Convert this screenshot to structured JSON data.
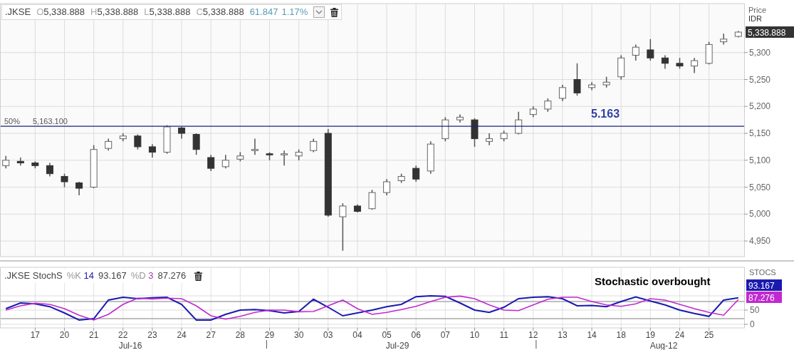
{
  "price_panel": {
    "legend": {
      "symbol": ".JKSE",
      "fields": [
        {
          "key": "O",
          "value": "5,338.888"
        },
        {
          "key": "H",
          "value": "5,338.888"
        },
        {
          "key": "L",
          "value": "5,338.888"
        },
        {
          "key": "C",
          "value": "5,338.888"
        }
      ],
      "change": "61.847",
      "change_percent": "1.17%"
    },
    "axis_title": [
      "Price",
      "IDR"
    ],
    "last_price": "5,338.888",
    "chart_data": {
      "type": "candlestick",
      "grid": true,
      "ylim": [
        4921,
        5391
      ],
      "categories": [
        null,
        null,
        null,
        null,
        null,
        null,
        null,
        null,
        null,
        null,
        null,
        null,
        null,
        null,
        null,
        null,
        null,
        null,
        null,
        null,
        null,
        null,
        null,
        null,
        null,
        null,
        null,
        null,
        null,
        null,
        null,
        null,
        null,
        null,
        null,
        null,
        null,
        null,
        null,
        null,
        null,
        null,
        null,
        null,
        null,
        null,
        null,
        null,
        null,
        null,
        null
      ],
      "yticks": [
        {
          "value": 4950,
          "label": "4,950"
        },
        {
          "value": 5000,
          "label": "5,000"
        },
        {
          "value": 5050,
          "label": "5,050"
        },
        {
          "value": 5100,
          "label": "5,100"
        },
        {
          "value": 5150,
          "label": "5,150"
        },
        {
          "value": 5200,
          "label": "5,200"
        },
        {
          "value": 5250,
          "label": "5,250"
        },
        {
          "value": 5300,
          "label": "5,300"
        }
      ],
      "ohlc": [
        [
          5090,
          5108,
          5085,
          5100
        ],
        [
          5098,
          5105,
          5090,
          5095
        ],
        [
          5095,
          5098,
          5085,
          5090
        ],
        [
          5090,
          5095,
          5070,
          5075
        ],
        [
          5070,
          5075,
          5050,
          5060
        ],
        [
          5058,
          5060,
          5035,
          5048
        ],
        [
          5050,
          5128,
          5048,
          5120
        ],
        [
          5122,
          5140,
          5118,
          5135
        ],
        [
          5140,
          5150,
          5135,
          5145
        ],
        [
          5145,
          5148,
          5120,
          5125
        ],
        [
          5125,
          5130,
          5105,
          5115
        ],
        [
          5115,
          5165,
          5112,
          5162
        ],
        [
          5160,
          5162,
          5140,
          5150
        ],
        [
          5148,
          5150,
          5110,
          5120
        ],
        [
          5105,
          5110,
          5080,
          5085
        ],
        [
          5088,
          5110,
          5085,
          5100
        ],
        [
          5102,
          5115,
          5098,
          5108
        ],
        [
          5118,
          5140,
          5110,
          5120
        ],
        [
          5112,
          5115,
          5100,
          5110
        ],
        [
          5110,
          5118,
          5090,
          5112
        ],
        [
          5108,
          5120,
          5100,
          5115
        ],
        [
          5118,
          5140,
          5115,
          5135
        ],
        [
          5150,
          5158,
          4995,
          4998
        ],
        [
          4995,
          5020,
          4932,
          5015
        ],
        [
          5015,
          5018,
          5003,
          5005
        ],
        [
          5010,
          5045,
          5008,
          5040
        ],
        [
          5040,
          5065,
          5035,
          5060
        ],
        [
          5062,
          5075,
          5058,
          5070
        ],
        [
          5085,
          5090,
          5060,
          5065
        ],
        [
          5080,
          5135,
          5075,
          5130
        ],
        [
          5140,
          5180,
          5135,
          5175
        ],
        [
          5175,
          5185,
          5170,
          5180
        ],
        [
          5175,
          5178,
          5125,
          5140
        ],
        [
          5135,
          5150,
          5128,
          5140
        ],
        [
          5140,
          5155,
          5135,
          5150
        ],
        [
          5150,
          5190,
          5148,
          5175
        ],
        [
          5185,
          5200,
          5180,
          5195
        ],
        [
          5195,
          5215,
          5190,
          5210
        ],
        [
          5215,
          5240,
          5210,
          5235
        ],
        [
          5250,
          5280,
          5220,
          5225
        ],
        [
          5235,
          5245,
          5230,
          5240
        ],
        [
          5240,
          5255,
          5235,
          5245
        ],
        [
          5255,
          5295,
          5250,
          5290
        ],
        [
          5295,
          5315,
          5285,
          5310
        ],
        [
          5305,
          5325,
          5285,
          5290
        ],
        [
          5290,
          5295,
          5270,
          5280
        ],
        [
          5280,
          5290,
          5270,
          5275
        ],
        [
          5275,
          5290,
          5262,
          5285
        ],
        [
          5280,
          5320,
          5278,
          5315
        ],
        [
          5320,
          5335,
          5315,
          5325
        ],
        [
          5330,
          5340,
          5328,
          5338
        ]
      ],
      "ref_lines": [
        {
          "axis": "y",
          "value": 5163.1,
          "color": "#1a237e",
          "label": "5,163.100"
        }
      ],
      "annotations": [
        {
          "text": "50%"
        },
        {
          "text": "5.163"
        }
      ]
    }
  },
  "stoch_panel": {
    "legend": {
      "symbol": ".JKSE",
      "study": "StochS",
      "k_period": "14",
      "k_value": "93.167",
      "d_period": "3",
      "d_value": "87.276"
    },
    "axis_title": "STOCS",
    "k_badge": "93.167",
    "d_badge": "87.276",
    "chart_data": {
      "type": "line",
      "grid": true,
      "ylim": [
        -12.5,
        200
      ],
      "yticks": [
        0,
        50
      ],
      "categories": [
        null,
        null,
        "17",
        null,
        "20",
        null,
        "21",
        null,
        "22",
        null,
        "23",
        null,
        "24",
        null,
        "27",
        null,
        "28",
        null,
        "29",
        null,
        "30",
        null,
        "03",
        null,
        "04",
        null,
        "05",
        null,
        "06",
        null,
        "07",
        null,
        "10",
        null,
        "11",
        null,
        "12",
        null,
        "13",
        null,
        "14",
        null,
        "18",
        null,
        "19",
        null,
        "24",
        null,
        "25",
        null,
        null
      ],
      "series": [
        {
          "name": "%K",
          "color": "#1a1ab0",
          "values": [
            55,
            75,
            72,
            62,
            40,
            15,
            20,
            85,
            95,
            90,
            93,
            95,
            70,
            15,
            15,
            35,
            50,
            52,
            48,
            40,
            45,
            88,
            60,
            30,
            40,
            50,
            62,
            70,
            97,
            100,
            98,
            75,
            50,
            42,
            60,
            90,
            95,
            97,
            90,
            65,
            66,
            62,
            80,
            96,
            82,
            68,
            50,
            38,
            28,
            85,
            93
          ]
        },
        {
          "name": "%D",
          "color": "#c02ad0",
          "values": [
            50,
            65,
            74,
            70,
            55,
            32,
            15,
            35,
            70,
            92,
            89,
            92,
            90,
            65,
            30,
            18,
            28,
            42,
            50,
            50,
            44,
            45,
            65,
            85,
            55,
            35,
            42,
            52,
            63,
            80,
            95,
            99,
            90,
            68,
            50,
            48,
            68,
            88,
            95,
            95,
            80,
            68,
            63,
            72,
            90,
            85,
            70,
            55,
            42,
            32,
            87
          ]
        }
      ],
      "ref_lines": [
        {
          "axis": "y",
          "value": 80
        },
        {
          "axis": "y",
          "value": 20
        }
      ],
      "annotations": [
        {
          "text": "Stochastic overbought"
        },
        {
          "text": "Jul-16"
        },
        {
          "text": "Jul-29"
        },
        {
          "text": "Aug-12"
        }
      ]
    }
  }
}
